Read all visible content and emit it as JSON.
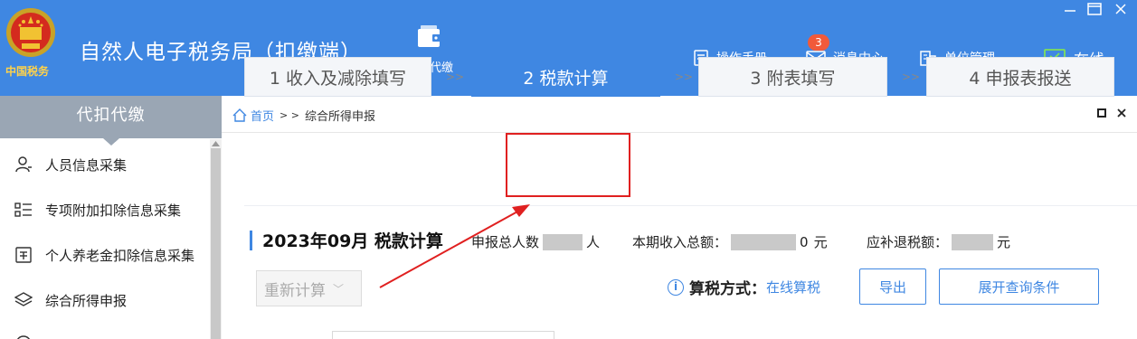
{
  "header": {
    "app_title": "自然人电子税务局（扣缴端）",
    "emblem_text": "中国税务",
    "nav_main_label": "代扣代缴",
    "manual_label": "操作手册",
    "messages_label": "消息中心",
    "messages_badge": "3",
    "unit_label": "单位管理",
    "online_label": "在线",
    "accent_color": "#3f87e2",
    "online_icon_color": "#7ee05a"
  },
  "sidebar": {
    "title": "代扣代缴",
    "items": [
      {
        "label": "人员信息采集",
        "icon": "person-icon"
      },
      {
        "label": "专项附加扣除信息采集",
        "icon": "list-icon"
      },
      {
        "label": "个人养老金扣除信息采集",
        "icon": "pension-icon"
      },
      {
        "label": "综合所得申报",
        "icon": "layers-icon"
      }
    ]
  },
  "main": {
    "breadcrumb": {
      "home": "首页",
      "separator": "> >",
      "current": "综合所得申报"
    },
    "steps": [
      {
        "label": "1 收入及减除填写",
        "active": false
      },
      {
        "label": "2 税款计算",
        "active": true
      },
      {
        "label": "3 附表填写",
        "active": false
      },
      {
        "label": "4 申报表报送",
        "active": false
      }
    ],
    "step_separator": ">>",
    "summary": {
      "title": "2023年09月  税款计算",
      "people_label": "申报总人数",
      "people_unit": "人",
      "income_label": "本期收入总额：",
      "income_visible_digit": "0",
      "income_unit": "元",
      "refund_label": "应补退税额：",
      "refund_unit": "元"
    },
    "recalc_label": "重新计算",
    "tax_mode_label": "算税方式：",
    "tax_mode_value": "在线算税",
    "export_label": "导出",
    "expand_label": "展开查询条件"
  }
}
